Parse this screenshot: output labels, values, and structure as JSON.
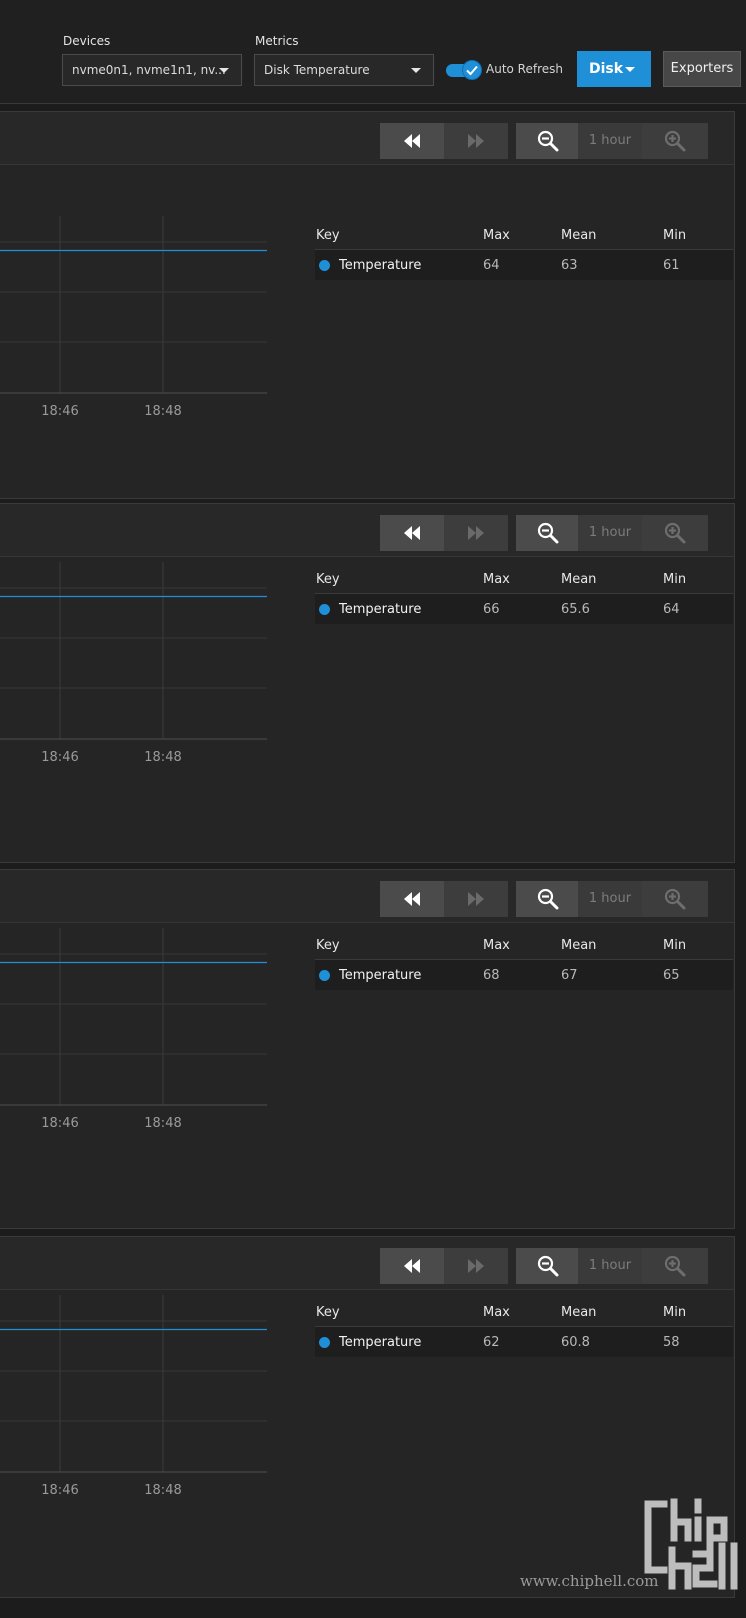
{
  "toolbar": {
    "devices": {
      "label": "Devices",
      "value": "nvme0n1, nvme1n1, nv..."
    },
    "metrics": {
      "label": "Metrics",
      "value": "Disk Temperature"
    },
    "auto_refresh": {
      "label": "Auto Refresh",
      "enabled": true
    },
    "disk_button": "Disk",
    "exporters_button": "Exporters"
  },
  "panel_controls": {
    "icons": [
      "rewind-icon",
      "fast-forward-icon",
      "zoom-out-icon",
      "zoom-in-icon"
    ],
    "zoom_label": "1 hour"
  },
  "legend_headers": {
    "key": "Key",
    "max": "Max",
    "mean": "Mean",
    "min": "Min"
  },
  "panels": [
    {
      "key": "Temperature",
      "max": "64",
      "mean": "63",
      "min": "61",
      "x_ticks": [
        "18:46",
        "18:48"
      ],
      "line_level": 0.81
    },
    {
      "key": "Temperature",
      "max": "66",
      "mean": "65.6",
      "min": "64",
      "x_ticks": [
        "18:46",
        "18:48"
      ],
      "line_level": 0.81
    },
    {
      "key": "Temperature",
      "max": "68",
      "mean": "67",
      "min": "65",
      "x_ticks": [
        "18:46",
        "18:48"
      ],
      "line_level": 0.81
    },
    {
      "key": "Temperature",
      "max": "62",
      "mean": "60.8",
      "min": "58",
      "x_ticks": [
        "18:46",
        "18:48"
      ],
      "line_level": 0.81
    }
  ],
  "colors": {
    "accent": "#1f8fd8",
    "background": "#1c1c1c",
    "panel": "#252525"
  },
  "watermark": {
    "text": "www.chiphell.com",
    "logo": "chiphell-logo"
  }
}
